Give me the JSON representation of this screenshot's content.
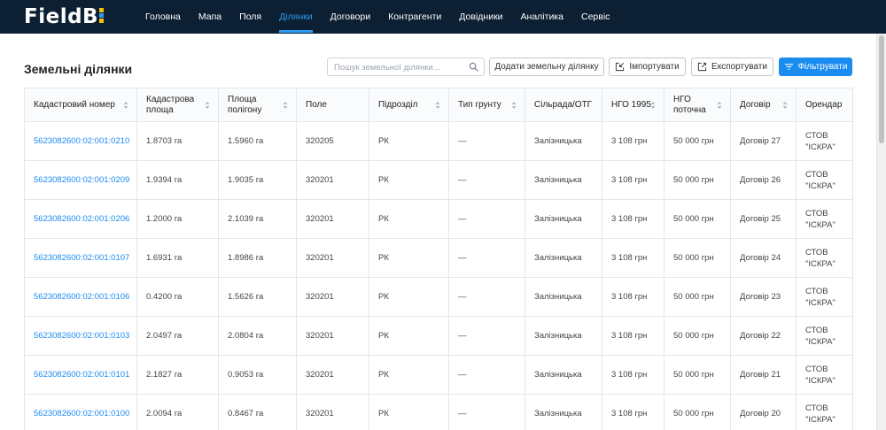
{
  "app": {
    "logo_text": "FieldB"
  },
  "nav": [
    {
      "label": "Головна",
      "active": false
    },
    {
      "label": "Мапа",
      "active": false
    },
    {
      "label": "Поля",
      "active": false
    },
    {
      "label": "Ділянки",
      "active": true
    },
    {
      "label": "Договори",
      "active": false
    },
    {
      "label": "Контрагенти",
      "active": false
    },
    {
      "label": "Довідники",
      "active": false
    },
    {
      "label": "Аналітика",
      "active": false
    },
    {
      "label": "Сервіс",
      "active": false
    }
  ],
  "page": {
    "title": "Земельні ділянки"
  },
  "search": {
    "placeholder": "Пошук земельної ділянки..."
  },
  "toolbar": {
    "add_label": "Додати земельну ділянку",
    "import_label": "Імпортувати",
    "export_label": "Експортувати",
    "filter_label": "Фільтрувати"
  },
  "colors": {
    "header_bg": "#0d1f33",
    "accent": "#1a8cf0",
    "logo_yellow": "#f2c500"
  },
  "table": {
    "columns": [
      {
        "label": "Кадастровий номер",
        "sortable": true
      },
      {
        "label": "Кадастрова площа",
        "sortable": true
      },
      {
        "label": "Площа полігону",
        "sortable": true
      },
      {
        "label": "Поле",
        "sortable": false
      },
      {
        "label": "Підрозділ",
        "sortable": true
      },
      {
        "label": "Тип грунту",
        "sortable": true
      },
      {
        "label": "Сільрада/ОТГ",
        "sortable": false
      },
      {
        "label": "НГО 1995",
        "sortable": true
      },
      {
        "label": "НГО поточна",
        "sortable": true
      },
      {
        "label": "Договір",
        "sortable": true
      },
      {
        "label": "Орендар",
        "sortable": false
      }
    ],
    "rows": [
      {
        "cad": "5623082600:02:001:0210",
        "area": "1.8703 га",
        "poly": "1.5960 га",
        "field": "320205",
        "unit": "РК",
        "soil": "—",
        "council": "Залізницька",
        "ngo1995": "3 108 грн",
        "ngo": "50 000 грн",
        "contract": "Договір 27",
        "tenant": "СТОВ \"ІСКРА\""
      },
      {
        "cad": "5623082600:02:001:0209",
        "area": "1.9394 га",
        "poly": "1.9035 га",
        "field": "320201",
        "unit": "РК",
        "soil": "—",
        "council": "Залізницька",
        "ngo1995": "3 108 грн",
        "ngo": "50 000 грн",
        "contract": "Договір 26",
        "tenant": "СТОВ \"ІСКРА\""
      },
      {
        "cad": "5623082600:02:001:0206",
        "area": "1.2000 га",
        "poly": "2.1039 га",
        "field": "320201",
        "unit": "РК",
        "soil": "—",
        "council": "Залізницька",
        "ngo1995": "3 108 грн",
        "ngo": "50 000 грн",
        "contract": "Договір 25",
        "tenant": "СТОВ \"ІСКРА\""
      },
      {
        "cad": "5623082600:02:001:0107",
        "area": "1.6931 га",
        "poly": "1.8986 га",
        "field": "320201",
        "unit": "РК",
        "soil": "—",
        "council": "Залізницька",
        "ngo1995": "3 108 грн",
        "ngo": "50 000 грн",
        "contract": "Договір 24",
        "tenant": "СТОВ \"ІСКРА\""
      },
      {
        "cad": "5623082600:02:001:0106",
        "area": "0.4200 га",
        "poly": "1.5626 га",
        "field": "320201",
        "unit": "РК",
        "soil": "—",
        "council": "Залізницька",
        "ngo1995": "3 108 грн",
        "ngo": "50 000 грн",
        "contract": "Договір 23",
        "tenant": "СТОВ \"ІСКРА\""
      },
      {
        "cad": "5623082600:02:001:0103",
        "area": "2.0497 га",
        "poly": "2.0804 га",
        "field": "320201",
        "unit": "РК",
        "soil": "—",
        "council": "Залізницька",
        "ngo1995": "3 108 грн",
        "ngo": "50 000 грн",
        "contract": "Договір 22",
        "tenant": "СТОВ \"ІСКРА\""
      },
      {
        "cad": "5623082600:02:001:0101",
        "area": "2.1827 га",
        "poly": "0.9053 га",
        "field": "320201",
        "unit": "РК",
        "soil": "—",
        "council": "Залізницька",
        "ngo1995": "3 108 грн",
        "ngo": "50 000 грн",
        "contract": "Договір 21",
        "tenant": "СТОВ \"ІСКРА\""
      },
      {
        "cad": "5623082600:02:001:0100",
        "area": "2.0094 га",
        "poly": "0.8467 га",
        "field": "320201",
        "unit": "РК",
        "soil": "—",
        "council": "Залізницька",
        "ngo1995": "3 108 грн",
        "ngo": "50 000 грн",
        "contract": "Договір 20",
        "tenant": "СТОВ \"ІСКРА\""
      }
    ]
  }
}
